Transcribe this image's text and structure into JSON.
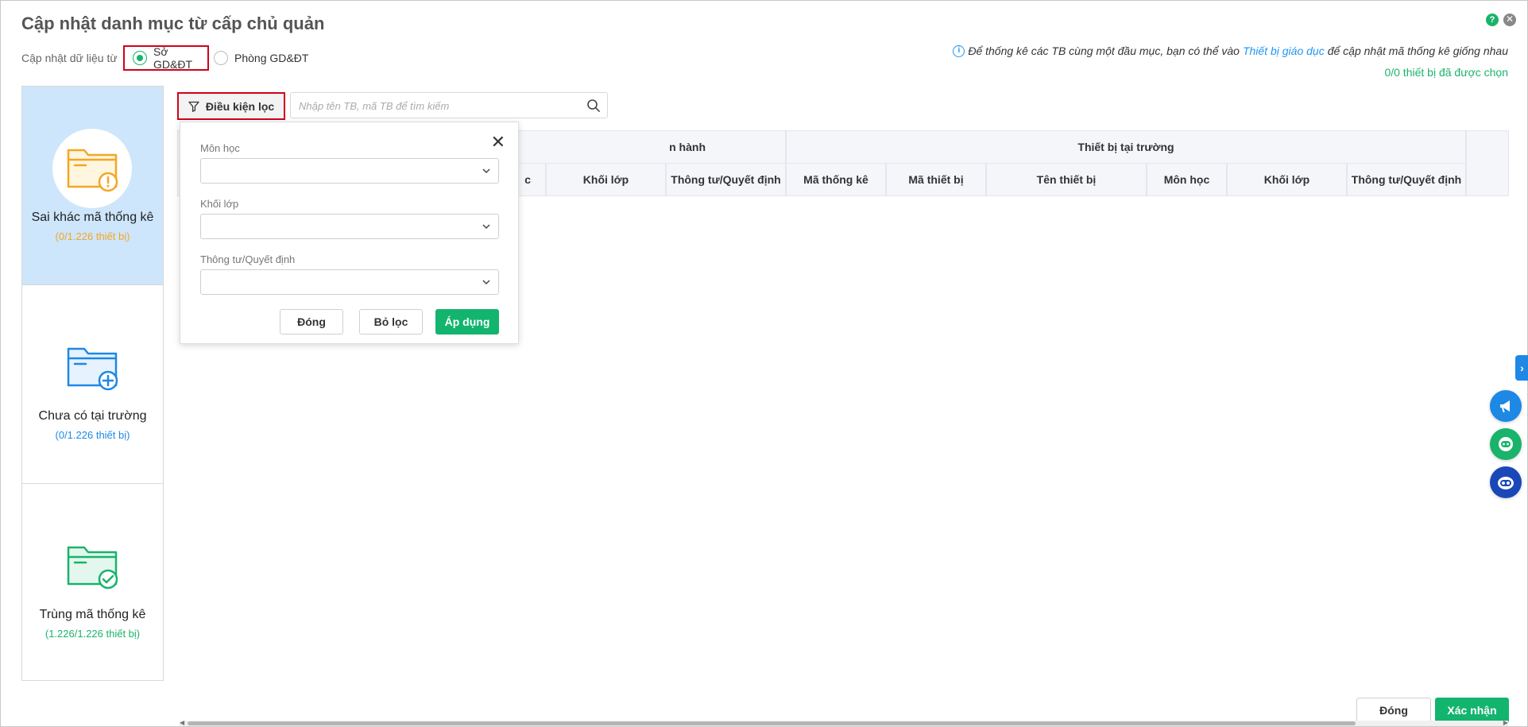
{
  "dialog": {
    "title": "Cập nhật danh mục từ cấp chủ quản",
    "source_label": "Cập nhật dữ liệu từ",
    "sources": [
      {
        "label": "Sở GD&ĐT",
        "checked": true
      },
      {
        "label": "Phòng GD&ĐT",
        "checked": false
      }
    ],
    "info": {
      "prefix": "Để thống kê các TB cùng một đầu mục, bạn có thể vào",
      "link": "Thiết bị giáo dục",
      "suffix": "để cập nhật mã thống kê giống nhau"
    },
    "selected_count": "0/0 thiết bị đã được chọn"
  },
  "categories": [
    {
      "title": "Sai khác mã thống kê",
      "count": "(0/1.226 thiết bị)",
      "color": "#f5a623",
      "icon": "folder-warning-icon"
    },
    {
      "title": "Chưa có tại trường",
      "count": "(0/1.226 thiết bị)",
      "color": "#1e88e5",
      "icon": "folder-add-icon"
    },
    {
      "title": "Trùng mã thống kê",
      "count": "(1.226/1.226 thiết bị)",
      "color": "#19b36b",
      "icon": "folder-check-icon"
    }
  ],
  "toolbar": {
    "filter_label": "Điều kiện lọc",
    "search_placeholder": "Nhập tên TB, mã TB để tìm kiếm"
  },
  "table": {
    "group_headers": {
      "left": "n hành",
      "right": "Thiết bị tại trường"
    },
    "left_columns": [
      "c",
      "Khối lớp",
      "Thông tư/Quyết định"
    ],
    "right_columns": [
      "Mã thống kê",
      "Mã thiết bị",
      "Tên thiết bị",
      "Môn học",
      "Khối lớp",
      "Thông tư/Quyết định"
    ]
  },
  "filter_popover": {
    "fields": [
      {
        "label": "Môn học",
        "value": ""
      },
      {
        "label": "Khối lớp",
        "value": ""
      },
      {
        "label": "Thông tư/Quyết định",
        "value": ""
      }
    ],
    "close_label": "Đóng",
    "clear_label": "Bỏ lọc",
    "apply_label": "Áp dụng"
  },
  "footer": {
    "close_label": "Đóng",
    "confirm_label": "Xác nhận"
  },
  "colors": {
    "accent_green": "#13b46e",
    "link_blue": "#2196f3",
    "highlight_red": "#d0021b",
    "active_panel": "#cde6fb"
  }
}
